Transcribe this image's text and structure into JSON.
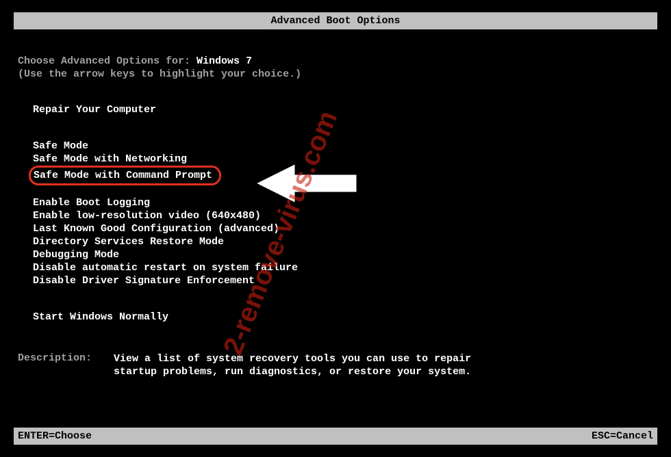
{
  "title": "Advanced Boot Options",
  "prompt": {
    "prefix": "Choose Advanced Options for: ",
    "os": "Windows 7",
    "hint": "(Use the arrow keys to highlight your choice.)"
  },
  "groups": {
    "repair": "Repair Your Computer",
    "safe0": "Safe Mode",
    "safe1": "Safe Mode with Networking",
    "safe2": "Safe Mode with Command Prompt",
    "adv0": "Enable Boot Logging",
    "adv1": "Enable low-resolution video (640x480)",
    "adv2": "Last Known Good Configuration (advanced)",
    "adv3": "Directory Services Restore Mode",
    "adv4": "Debugging Mode",
    "adv5": "Disable automatic restart on system failure",
    "adv6": "Disable Driver Signature Enforcement",
    "normal": "Start Windows Normally"
  },
  "description": {
    "label": "Description:",
    "line1": "View a list of system recovery tools you can use to repair",
    "line2": "startup problems, run diagnostics, or restore your system."
  },
  "footer": {
    "enter": "ENTER=Choose",
    "esc": "ESC=Cancel"
  },
  "watermark": "2-remove-virus.com"
}
